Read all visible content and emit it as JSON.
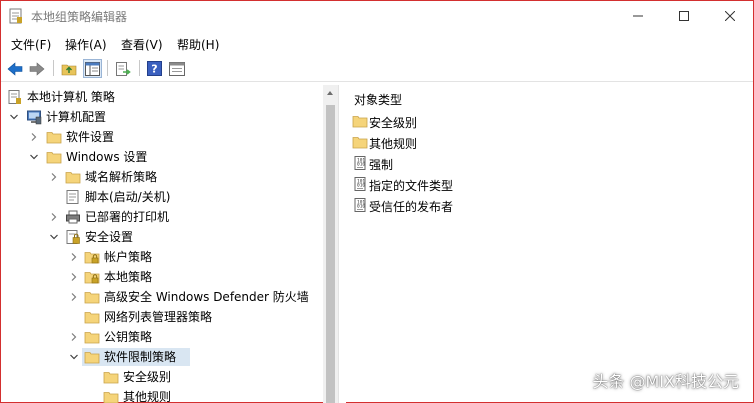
{
  "window": {
    "title": "本地组策略编辑器"
  },
  "menubar": {
    "items": [
      "文件(F)",
      "操作(A)",
      "查看(V)",
      "帮助(H)"
    ]
  },
  "toolbar": {
    "buttons": [
      "back-icon",
      "forward-icon",
      "up-folder-icon",
      "show-hide-tree-icon",
      "export-list-icon",
      "help-icon",
      "properties-icon"
    ]
  },
  "tree": {
    "items": [
      {
        "label": "本地计算机 策略",
        "icon": "policy-icon",
        "level": 0,
        "expander": "none"
      },
      {
        "label": "计算机配置",
        "icon": "computer-icon",
        "level": 1,
        "expander": "expanded"
      },
      {
        "label": "软件设置",
        "icon": "folder-icon",
        "level": 2,
        "expander": "collapsed"
      },
      {
        "label": "Windows 设置",
        "icon": "folder-icon",
        "level": 2,
        "expander": "expanded"
      },
      {
        "label": "域名解析策略",
        "icon": "folder-icon",
        "level": 3,
        "expander": "collapsed"
      },
      {
        "label": "脚本(启动/关机)",
        "icon": "script-icon",
        "level": 3,
        "expander": "none"
      },
      {
        "label": "已部署的打印机",
        "icon": "printer-icon",
        "level": 3,
        "expander": "collapsed"
      },
      {
        "label": "安全设置",
        "icon": "security-icon",
        "level": 3,
        "expander": "expanded"
      },
      {
        "label": "帐户策略",
        "icon": "folder-lock-icon",
        "level": 4,
        "expander": "collapsed"
      },
      {
        "label": "本地策略",
        "icon": "folder-lock-icon",
        "level": 4,
        "expander": "collapsed"
      },
      {
        "label": "高级安全 Windows Defender 防火墙",
        "icon": "folder-icon",
        "level": 4,
        "expander": "collapsed"
      },
      {
        "label": "网络列表管理器策略",
        "icon": "folder-icon",
        "level": 4,
        "expander": "none"
      },
      {
        "label": "公钥策略",
        "icon": "folder-icon",
        "level": 4,
        "expander": "collapsed"
      },
      {
        "label": "软件限制策略",
        "icon": "folder-icon",
        "level": 4,
        "expander": "expanded",
        "selected": true
      },
      {
        "label": "安全级别",
        "icon": "folder-icon",
        "level": 5,
        "expander": "none"
      },
      {
        "label": "其他规则",
        "icon": "folder-icon",
        "level": 5,
        "expander": "none"
      }
    ]
  },
  "list": {
    "header": "对象类型",
    "items": [
      {
        "label": "安全级别",
        "icon": "folder-icon"
      },
      {
        "label": "其他规则",
        "icon": "folder-icon"
      },
      {
        "label": "强制",
        "icon": "document-icon"
      },
      {
        "label": "指定的文件类型",
        "icon": "document-icon"
      },
      {
        "label": "受信任的发布者",
        "icon": "document-icon"
      }
    ]
  },
  "watermark": "头条 @MIX科技公元",
  "colors": {
    "window_border": "#d32f2f",
    "folder": "#f5d47a",
    "selection": "#d9e6f2",
    "accent_blue": "#1e6fc9",
    "arrow_green": "#4caf50"
  }
}
